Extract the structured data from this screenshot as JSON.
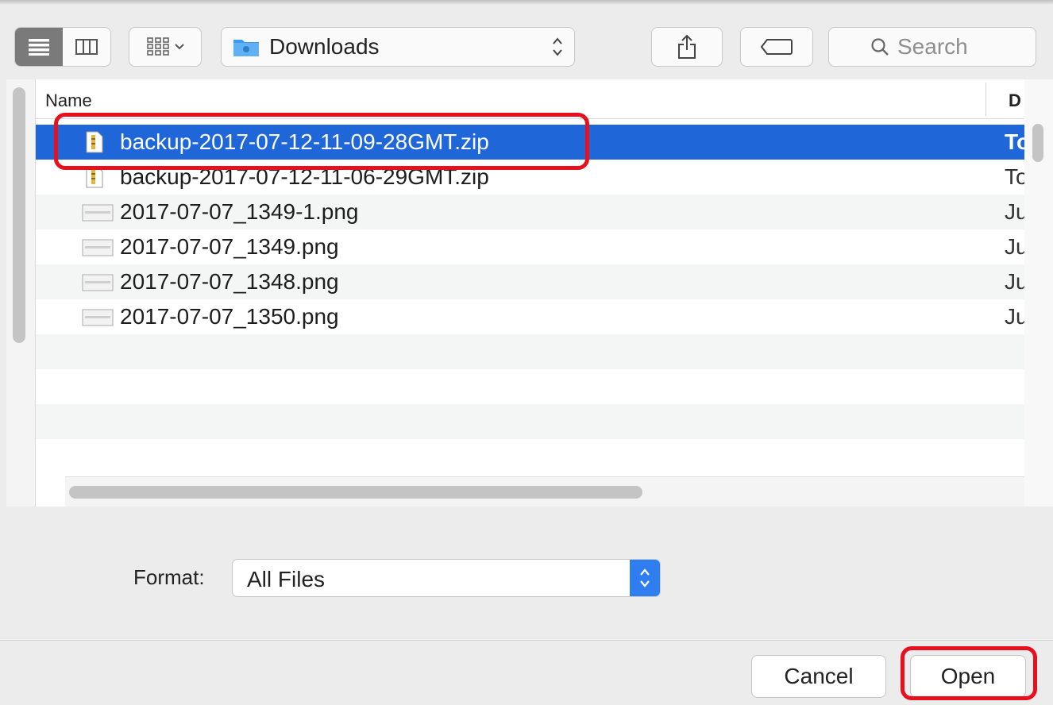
{
  "toolbar": {
    "view_modes": [
      "list-view",
      "column-view"
    ],
    "location": "Downloads",
    "search_placeholder": "Search"
  },
  "file_list": {
    "columns": {
      "name": "Name",
      "date": "D"
    },
    "rows": [
      {
        "name": "backup-2017-07-12-11-09-28GMT.zip",
        "date": "To",
        "icon": "zip-file-icon",
        "selected": true
      },
      {
        "name": "backup-2017-07-12-11-06-29GMT.zip",
        "date": "To",
        "icon": "zip-file-icon",
        "selected": false
      },
      {
        "name": "2017-07-07_1349-1.png",
        "date": "Ju",
        "icon": "image-file-icon",
        "selected": false
      },
      {
        "name": "2017-07-07_1349.png",
        "date": "Ju",
        "icon": "image-file-icon",
        "selected": false
      },
      {
        "name": "2017-07-07_1348.png",
        "date": "Ju",
        "icon": "image-file-icon",
        "selected": false
      },
      {
        "name": "2017-07-07_1350.png",
        "date": "Ju",
        "icon": "image-file-icon",
        "selected": false
      }
    ]
  },
  "format": {
    "label": "Format:",
    "value": "All Files"
  },
  "buttons": {
    "cancel": "Cancel",
    "open": "Open"
  },
  "colors": {
    "selection": "#1f66d8",
    "accent": "#2f7ef0",
    "highlight": "#e8101c",
    "folder": "#3a9cf0"
  }
}
